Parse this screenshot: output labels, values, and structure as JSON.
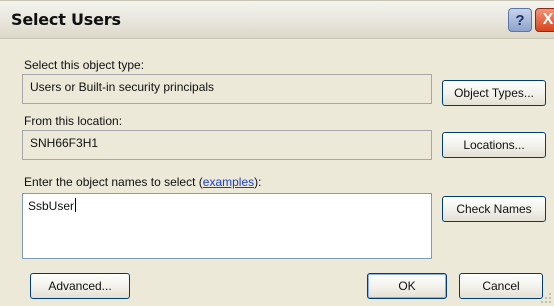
{
  "window": {
    "title": "Select Users",
    "help_symbol": "?",
    "close_symbol": "X"
  },
  "object_type": {
    "label": "Select this object type:",
    "value": "Users or Built-in security principals",
    "button": "Object Types..."
  },
  "location": {
    "label": "From this location:",
    "value": "SNH66F3H1",
    "button": "Locations..."
  },
  "names": {
    "label_prefix": "Enter the object names to select (",
    "link": "examples",
    "label_suffix": "):",
    "value": "SsbUser",
    "button": "Check Names"
  },
  "footer": {
    "advanced": "Advanced...",
    "ok": "OK",
    "cancel": "Cancel"
  }
}
